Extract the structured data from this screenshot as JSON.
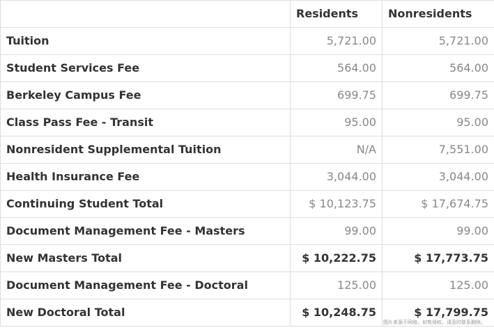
{
  "table": {
    "headers": [
      "",
      "Residents",
      "Nonresidents"
    ],
    "rows": [
      {
        "label": "Tuition",
        "residents": "5,721.00",
        "nonresidents": "5,721.00",
        "total": false
      },
      {
        "label": "Student Services Fee",
        "residents": "564.00",
        "nonresidents": "564.00",
        "total": false
      },
      {
        "label": "Berkeley Campus Fee",
        "residents": "699.75",
        "nonresidents": "699.75",
        "total": false
      },
      {
        "label": "Class Pass Fee - Transit",
        "residents": "95.00",
        "nonresidents": "95.00",
        "total": false
      },
      {
        "label": "Nonresident Supplemental Tuition",
        "residents": "N/A",
        "nonresidents": "7,551.00",
        "total": false
      },
      {
        "label": "Health Insurance Fee",
        "residents": "3,044.00",
        "nonresidents": "3,044.00",
        "total": false
      },
      {
        "label": "Continuing Student Total",
        "residents": "$ 10,123.75",
        "nonresidents": "$ 17,674.75",
        "total": false
      },
      {
        "label": "Document Management Fee - Masters",
        "residents": "99.00",
        "nonresidents": "99.00",
        "total": false
      },
      {
        "label": "New Masters Total",
        "residents": "$ 10,222.75",
        "nonresidents": "$ 17,773.75",
        "total": true
      },
      {
        "label": "Document Management Fee - Doctoral",
        "residents": "125.00",
        "nonresidents": "125.00",
        "total": false
      },
      {
        "label": "New Doctoral Total",
        "residents": "$ 10,248.75",
        "nonresidents": "$ 17,799.75",
        "total": true
      }
    ]
  },
  "watermark": "图片来源于网络，如有侵权，请及时联系删除。",
  "colors": {
    "border": "#dddddd",
    "text": "#333333",
    "muted_value": "#888888"
  }
}
